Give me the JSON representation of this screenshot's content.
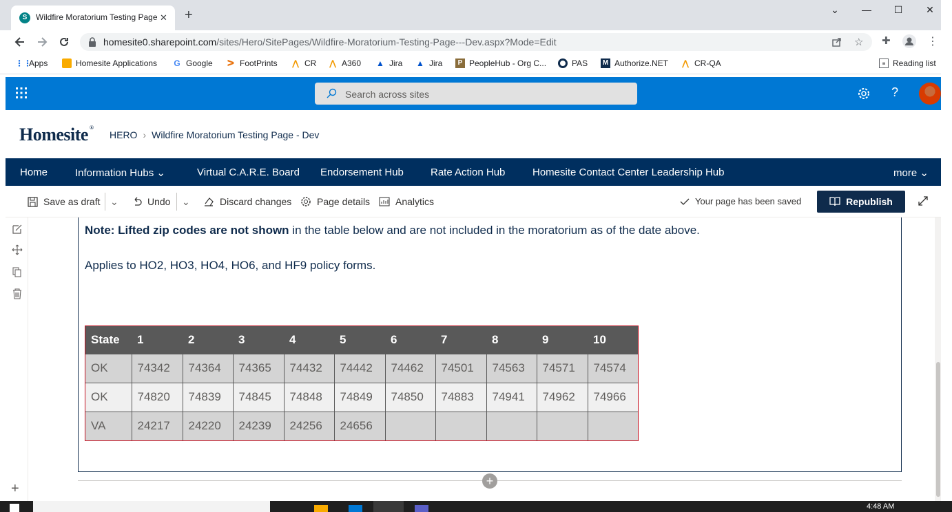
{
  "browser": {
    "tab_title": "Wildfire Moratorium Testing Page - Dev",
    "tab_favicon": "S",
    "url_domain": "homesite0.sharepoint.com",
    "url_path": "/sites/Hero/SitePages/Wildfire-Moratorium-Testing-Page---Dev.aspx?Mode=Edit"
  },
  "bookmarks": [
    {
      "label": "Apps",
      "icon": "apps-grid-icon"
    },
    {
      "label": "Homesite Applications",
      "icon": "folder-icon"
    },
    {
      "label": "Google",
      "icon": "google-icon"
    },
    {
      "label": "FootPrints",
      "icon": "footprints-icon"
    },
    {
      "label": "CR",
      "icon": "alfresco-icon"
    },
    {
      "label": "A360",
      "icon": "alfresco-icon"
    },
    {
      "label": "Jira",
      "icon": "jira-icon"
    },
    {
      "label": "Jira",
      "icon": "jira-icon"
    },
    {
      "label": "PeopleHub - Org C...",
      "icon": "peoplehub-icon"
    },
    {
      "label": "PAS",
      "icon": "pas-icon"
    },
    {
      "label": "Authorize.NET",
      "icon": "authorize-icon"
    },
    {
      "label": "CR-QA",
      "icon": "alfresco-icon"
    }
  ],
  "reading_list": "Reading list",
  "suite": {
    "search_placeholder": "Search across sites"
  },
  "site": {
    "logo": "Homesite",
    "breadcrumb_root": "HERO",
    "breadcrumb_page": "Wildfire Moratorium Testing Page - Dev"
  },
  "hubnav": {
    "items": [
      "Home",
      "Information Hubs",
      "Virtual C.A.R.E. Board",
      "Endorsement Hub",
      "Rate Action Hub",
      "Homesite Contact Center Leadership Hub"
    ],
    "more": "more"
  },
  "commandbar": {
    "save_draft": "Save as draft",
    "undo": "Undo",
    "discard": "Discard changes",
    "page_details": "Page details",
    "analytics": "Analytics",
    "status": "Your page has been saved",
    "republish": "Republish"
  },
  "content": {
    "note_bold": "Note: Lifted zip codes are not shown",
    "note_rest": " in the table below and are not included in the moratorium as of the date above.",
    "applies": "Applies to HO2, HO3, HO4, HO6, and HF9 policy forms.",
    "table": {
      "headers": [
        "State",
        "1",
        "2",
        "3",
        "4",
        "5",
        "6",
        "7",
        "8",
        "9",
        "10"
      ],
      "rows": [
        [
          "OK",
          "74342",
          "74364",
          "74365",
          "74432",
          "74442",
          "74462",
          "74501",
          "74563",
          "74571",
          "74574"
        ],
        [
          "OK",
          "74820",
          "74839",
          "74845",
          "74848",
          "74849",
          "74850",
          "74883",
          "74941",
          "74962",
          "74966"
        ],
        [
          "VA",
          "24217",
          "24220",
          "24239",
          "24256",
          "24656",
          "",
          "",
          "",
          "",
          ""
        ]
      ]
    }
  },
  "taskbar": {
    "clock": "4:48 AM"
  },
  "colors": {
    "suite_blue": "#0078d4",
    "navy": "#0f2b4c",
    "hub_nav": "#002f5f",
    "table_header": "#595959",
    "table_border": "#c50f1f"
  }
}
